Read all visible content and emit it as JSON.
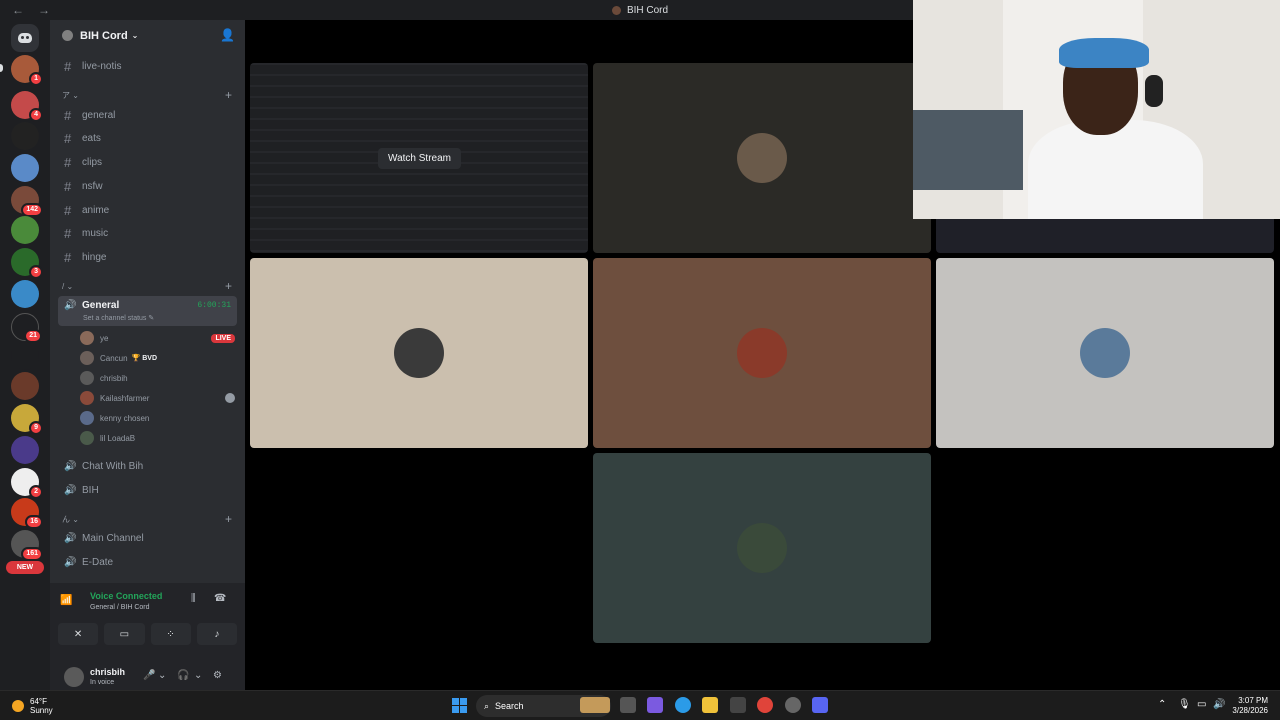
{
  "window": {
    "title": "BIH Cord"
  },
  "server_list": {
    "badges": [
      "1",
      "4",
      "142",
      "3",
      "21",
      "9",
      "2",
      "16",
      "161"
    ],
    "new_label": "NEW"
  },
  "guild": {
    "name": "BIH Cord"
  },
  "channels": {
    "top": [
      {
        "name": "live-notis"
      }
    ],
    "cat1": {
      "name": "ア"
    },
    "text": [
      {
        "name": "general"
      },
      {
        "name": "eats"
      },
      {
        "name": "clips"
      },
      {
        "name": "nsfw"
      },
      {
        "name": "anime"
      },
      {
        "name": "music"
      },
      {
        "name": "hinge"
      }
    ],
    "cat2": {
      "name": "/"
    },
    "voice_active": {
      "name": "General",
      "timer": "6:00:31",
      "status": "Set a channel status"
    },
    "voice_users": [
      {
        "name": "ye",
        "live": "LIVE",
        "color": "#8a6a5a"
      },
      {
        "name": "Cancun",
        "tag": "🏆 BVD",
        "color": "#6b5f5a"
      },
      {
        "name": "chrisbih",
        "color": "#5a5a5a"
      },
      {
        "name": "Kailashfarmer",
        "color": "#8a4a3a"
      },
      {
        "name": "kenny chosen",
        "color": "#5a6a8a"
      },
      {
        "name": "lil LoadaB",
        "color": "#4a5a4a"
      }
    ],
    "voice_other": [
      {
        "name": "Chat With Bih"
      },
      {
        "name": "BIH"
      }
    ],
    "cat3": {
      "name": "ん"
    },
    "voice_more": [
      {
        "name": "Main Channel"
      },
      {
        "name": "E-Date"
      }
    ]
  },
  "voice_panel": {
    "status": "Voice Connected",
    "location": "General / BIH Cord"
  },
  "user_panel": {
    "name": "chrisbih",
    "status": "In voice"
  },
  "stage": {
    "watch_stream": "Watch Stream",
    "tiles": [
      {
        "color": "#2b2a26",
        "avatar": "#6a5a4a"
      },
      {
        "color": "#cbbfae",
        "avatar": "#3a3a3a"
      },
      {
        "color": "#6e4f3e",
        "avatar": "#8a3a2a"
      },
      {
        "color": "#c4c2bf",
        "avatar": "#5a7a9a"
      },
      {
        "color": "#344140",
        "avatar": "#3a4a3a"
      }
    ]
  },
  "taskbar": {
    "weather_temp": "64°F",
    "weather_desc": "Sunny",
    "search": "Search",
    "time": "3:07 PM",
    "date": "3/28/2026"
  }
}
